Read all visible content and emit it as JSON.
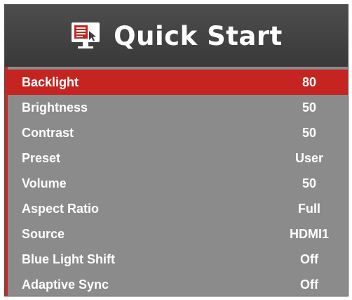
{
  "header": {
    "title": "Quick Start",
    "icon": "monitor-cursor-icon"
  },
  "colors": {
    "header_bg": "#414141",
    "panel_bg": "#8b8b8b",
    "selected_bg": "#c52421",
    "text": "#ffffff"
  },
  "menu": {
    "selected_index": 0,
    "items": [
      {
        "label": "Backlight",
        "value": "80"
      },
      {
        "label": "Brightness",
        "value": "50"
      },
      {
        "label": "Contrast",
        "value": "50"
      },
      {
        "label": "Preset",
        "value": "User"
      },
      {
        "label": "Volume",
        "value": "50"
      },
      {
        "label": "Aspect Ratio",
        "value": "Full"
      },
      {
        "label": "Source",
        "value": "HDMI1"
      },
      {
        "label": "Blue Light Shift",
        "value": "Off"
      },
      {
        "label": "Adaptive Sync",
        "value": "Off"
      }
    ]
  }
}
